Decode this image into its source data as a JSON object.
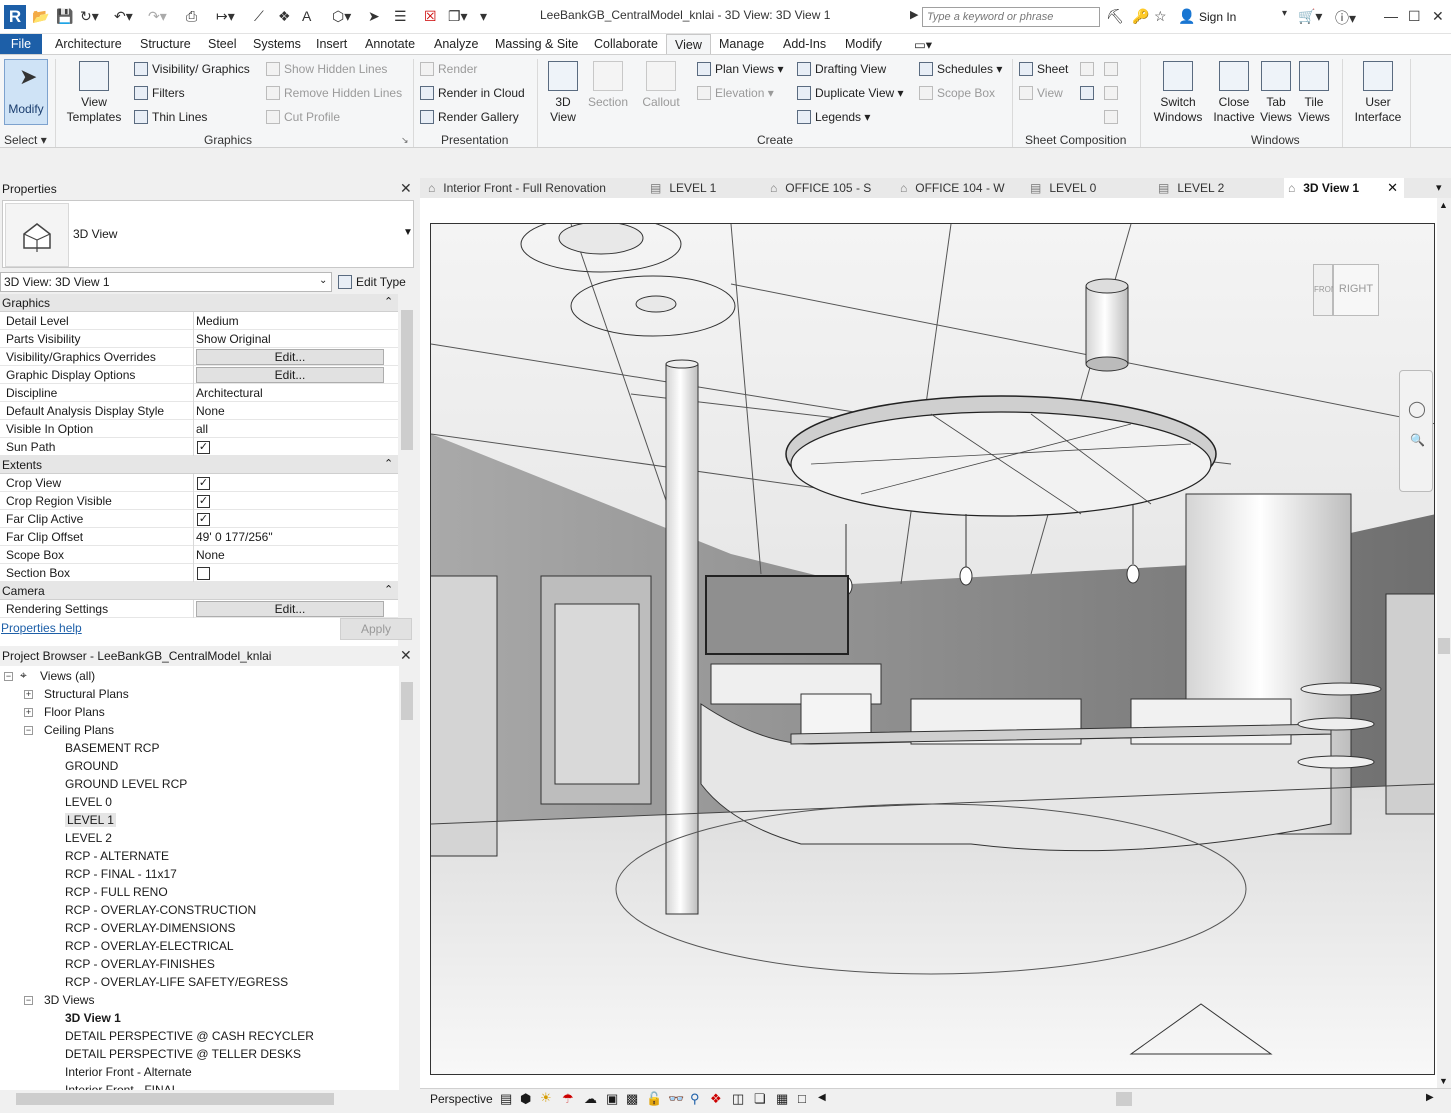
{
  "window": {
    "title": "LeeBankGB_CentralModel_knlai - 3D View: 3D View 1",
    "search_placeholder": "Type a keyword or phrase",
    "sign_in": "Sign In",
    "logo": "R"
  },
  "ribbon_tabs": [
    "File",
    "Architecture",
    "Structure",
    "Steel",
    "Systems",
    "Insert",
    "Annotate",
    "Analyze",
    "Massing & Site",
    "Collaborate",
    "View",
    "Manage",
    "Add-Ins",
    "Modify"
  ],
  "active_tab": "View",
  "ribbon": {
    "select": {
      "modify": "Modify",
      "label": "Select"
    },
    "graphics": {
      "label": "Graphics",
      "view_templates": "View Templates",
      "vis_graphics": "Visibility/ Graphics",
      "filters": "Filters",
      "thin_lines": "Thin Lines",
      "show_hidden": "Show Hidden Lines",
      "remove_hidden": "Remove Hidden Lines",
      "cut_profile": "Cut Profile"
    },
    "presentation": {
      "label": "Presentation",
      "render": "Render",
      "render_cloud": "Render in Cloud",
      "render_gallery": "Render Gallery"
    },
    "create": {
      "label": "Create",
      "view3d": "3D View",
      "section": "Section",
      "callout": "Callout",
      "plan_views": "Plan Views",
      "elevation": "Elevation",
      "drafting": "Drafting View",
      "duplicate": "Duplicate View",
      "legends": "Legends",
      "schedules": "Schedules",
      "scope_box": "Scope Box"
    },
    "sheet_composition": {
      "label": "Sheet Composition",
      "sheet": "Sheet",
      "view": "View"
    },
    "windows": {
      "label": "Windows",
      "switch": "Switch Windows",
      "close_inactive": "Close Inactive",
      "tab_views": "Tab Views",
      "tile_views": "Tile Views",
      "user_interface": "User Interface"
    }
  },
  "properties": {
    "title": "Properties",
    "type_name": "3D View",
    "instance": "3D View: 3D View 1",
    "edit_type": "Edit Type",
    "rows": [
      {
        "cat": "Graphics"
      },
      {
        "k": "Detail Level",
        "v": "Medium"
      },
      {
        "k": "Parts Visibility",
        "v": "Show Original"
      },
      {
        "k": "Visibility/Graphics Overrides",
        "btn": "Edit..."
      },
      {
        "k": "Graphic Display Options",
        "btn": "Edit..."
      },
      {
        "k": "Discipline",
        "v": "Architectural"
      },
      {
        "k": "Default Analysis Display Style",
        "v": "None"
      },
      {
        "k": "Visible In Option",
        "v": "all"
      },
      {
        "k": "Sun Path",
        "chk": true
      },
      {
        "cat": "Extents"
      },
      {
        "k": "Crop View",
        "chk": true
      },
      {
        "k": "Crop Region Visible",
        "chk": true
      },
      {
        "k": "Far Clip Active",
        "chk": true
      },
      {
        "k": "Far Clip Offset",
        "v": "49'  0 177/256\""
      },
      {
        "k": "Scope Box",
        "v": "None"
      },
      {
        "k": "Section Box",
        "chk": false
      },
      {
        "cat": "Camera"
      },
      {
        "k": "Rendering Settings",
        "btn": "Edit..."
      }
    ],
    "help": "Properties help",
    "apply": "Apply"
  },
  "browser": {
    "title": "Project Browser - LeeBankGB_CentralModel_knlai",
    "nodes": [
      {
        "t": "Views (all)",
        "lvl": 0,
        "tog": "-"
      },
      {
        "t": "Structural Plans",
        "lvl": 1,
        "tog": "+"
      },
      {
        "t": "Floor Plans",
        "lvl": 1,
        "tog": "+"
      },
      {
        "t": "Ceiling Plans",
        "lvl": 1,
        "tog": "-"
      },
      {
        "t": "BASEMENT RCP",
        "lvl": 2
      },
      {
        "t": "GROUND",
        "lvl": 2
      },
      {
        "t": "GROUND LEVEL RCP",
        "lvl": 2
      },
      {
        "t": "LEVEL 0",
        "lvl": 2
      },
      {
        "t": "LEVEL 1",
        "lvl": 2,
        "sel": true
      },
      {
        "t": "LEVEL 2",
        "lvl": 2
      },
      {
        "t": "RCP - ALTERNATE",
        "lvl": 2
      },
      {
        "t": "RCP - FINAL - 11x17",
        "lvl": 2
      },
      {
        "t": "RCP - FULL RENO",
        "lvl": 2
      },
      {
        "t": "RCP - OVERLAY-CONSTRUCTION",
        "lvl": 2
      },
      {
        "t": "RCP - OVERLAY-DIMENSIONS",
        "lvl": 2
      },
      {
        "t": "RCP - OVERLAY-ELECTRICAL",
        "lvl": 2
      },
      {
        "t": "RCP - OVERLAY-FINISHES",
        "lvl": 2
      },
      {
        "t": "RCP - OVERLAY-LIFE SAFETY/EGRESS",
        "lvl": 2
      },
      {
        "t": "3D Views",
        "lvl": 1,
        "tog": "-"
      },
      {
        "t": "3D View 1",
        "lvl": 2,
        "bold": true
      },
      {
        "t": "DETAIL PERSPECTIVE @ CASH RECYCLER",
        "lvl": 2
      },
      {
        "t": "DETAIL PERSPECTIVE @ TELLER DESKS",
        "lvl": 2
      },
      {
        "t": "Interior Front - Alternate",
        "lvl": 2
      },
      {
        "t": "Interior Front - FINAL",
        "lvl": 2
      }
    ]
  },
  "view_tabs": [
    {
      "label": "Interior Front - Full Renovation",
      "icon": "3d-view-icon"
    },
    {
      "label": "LEVEL 1",
      "icon": "plan-icon"
    },
    {
      "label": "OFFICE 105 - S",
      "icon": "elevation-icon"
    },
    {
      "label": "OFFICE 104 - W",
      "icon": "elevation-icon"
    },
    {
      "label": "LEVEL 0",
      "icon": "plan-icon"
    },
    {
      "label": "LEVEL 2",
      "icon": "plan-icon"
    },
    {
      "label": "3D View 1",
      "icon": "3d-view-icon",
      "active": true
    }
  ],
  "viewcube": {
    "front": "FRONT",
    "right": "RIGHT"
  },
  "status": {
    "mode": "Perspective"
  }
}
